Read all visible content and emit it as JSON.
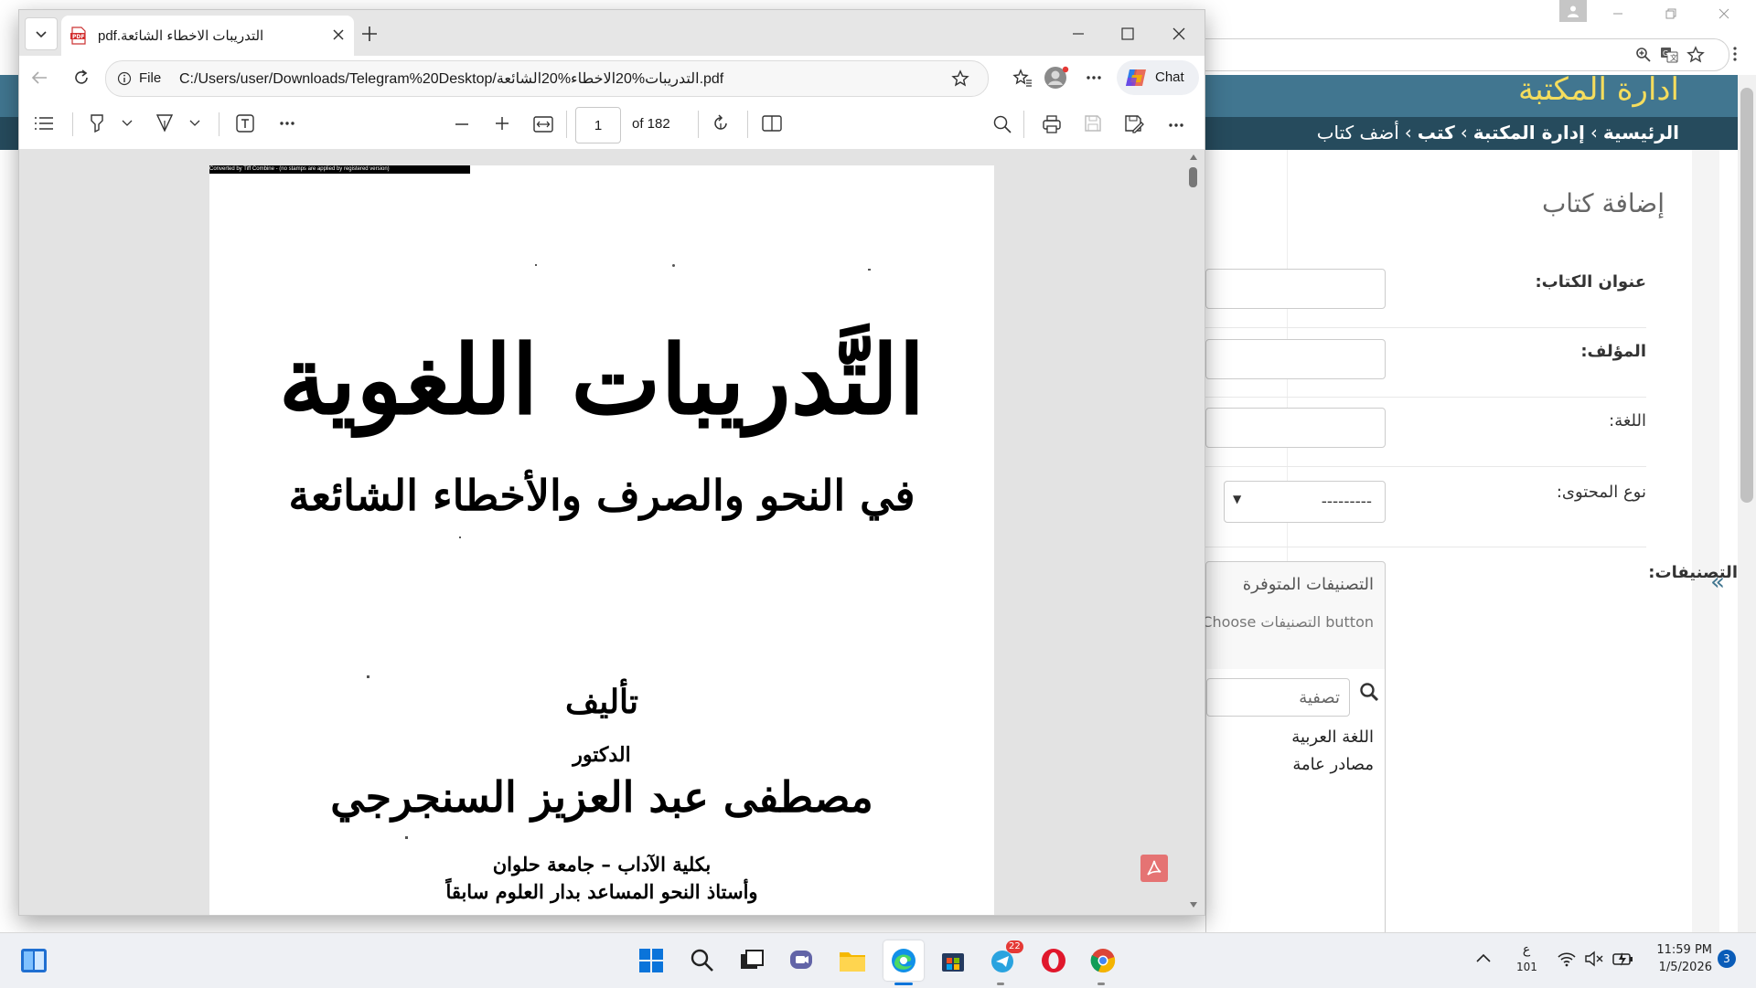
{
  "background_app": {
    "site_title": "ادارة المكتبة",
    "breadcrumbs": [
      "الرئيسية",
      "إدارة المكتبة",
      "كتب",
      "أضف كتاب"
    ],
    "breadcrumb_separator": "›",
    "form_title": "إضافة كتاب",
    "fields": [
      {
        "label": "عنوان الكتاب:",
        "value": ""
      },
      {
        "label": "المؤلف:",
        "value": ""
      },
      {
        "label": "اللغة:",
        "value": ""
      }
    ],
    "content_type": {
      "label": "نوع المحتوى:",
      "selected": "---------"
    },
    "categories": {
      "label": "التصنيفات:",
      "panel_title": "التصنيفات المتوفرة",
      "help_text": "Choose التصنيفات button",
      "filter_placeholder": "تصفية",
      "options": [
        "اللغة العربية",
        "مصادر عامة"
      ]
    },
    "collapse_glyph": "«",
    "colors": {
      "header": "#417690",
      "breadcrumbs": "#264b5d",
      "title": "#f5dd5d"
    }
  },
  "edge": {
    "tab_title": "pdf.التدريبات الاخطاء الشائعة",
    "address_prefix": "File",
    "address_url": "C:/Users/user/Downloads/Telegram%20Desktop/التدريبات%20الاخطاء%20الشائعة.pdf",
    "copilot_label": "Chat",
    "page_input": "1",
    "page_total": "of 182",
    "pdf_banner": "Converted by Tiff Combine - (no stamps are applied by registered version)"
  },
  "document": {
    "title": "التَّدريبات اللغوية",
    "subtitle": "في النحو والصرف والأخطاء الشائعة",
    "authored_label": "تأليف",
    "doctor_label": "الدكتور",
    "author_name": "مصطفى عبد العزيز السنجرجي",
    "affiliation": "بكلية الآداب – جامعة حلوان",
    "former_position": "وأستاذ النحو المساعد بدار العلوم سابقاً"
  },
  "taskbar": {
    "lang_code": "ع",
    "lang_sub": "101",
    "time": "11:59 PM",
    "date": "1/5/2026",
    "notification_count": "3",
    "telegram_badge": "22"
  }
}
